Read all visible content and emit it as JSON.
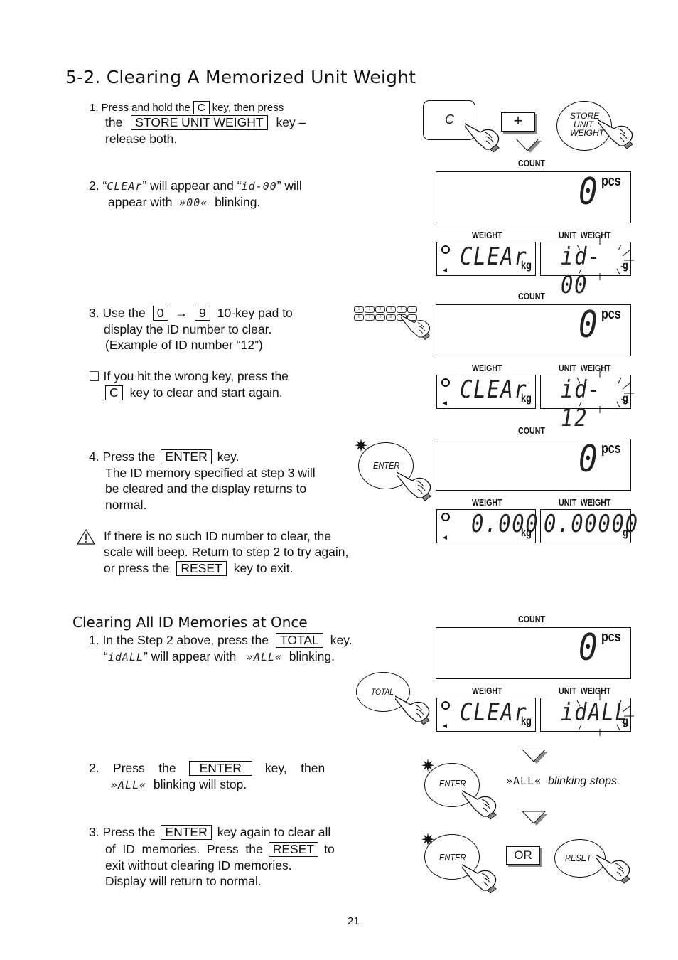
{
  "page": {
    "title": "5-2. Clearing A Memorized Unit Weight",
    "page_number": "21"
  },
  "section1": {
    "step1": {
      "l1_a": "1. Press and hold the",
      "key_c": "C",
      "l1_b": "key, then press",
      "l2_a": "the",
      "key_store": "STORE  UNIT  WEIGHT",
      "l2_b": "key  –",
      "l3": "release both."
    },
    "step2": {
      "l1_a": "2. “",
      "seg_clear": "CLEAr",
      "l1_b": "”  will  appear  and  “",
      "seg_id": "id-00",
      "l1_c": "”  will",
      "l2_a": "appear with",
      "seg_blink": "»00«",
      "l2_b": "blinking."
    },
    "step3": {
      "l1_a": "3.  Use  the",
      "key_0": "0",
      "arrow": "→",
      "key_9": "9",
      "l1_b": "10-key  pad  to",
      "l2": "display the ID number to clear.",
      "l3": "(Example of ID number “12”)",
      "note_l1": "❏ If you hit the wrong key, press the",
      "key_c": "C",
      "note_l2": "key to clear and start again."
    },
    "step4": {
      "l1_a": "4. Press the",
      "key_enter": "ENTER",
      "l1_b": "key.",
      "l2": "The ID memory specified at step 3 will",
      "l3": "be  cleared  and  the  display  returns  to",
      "l4": "normal.",
      "warn_l1": "If  there  is  no  such  ID  number  to  clear,  the",
      "warn_l2": "scale will beep. Return to step 2 to try again,",
      "warn_l3_a": "or press the",
      "key_reset": "RESET",
      "warn_l3_b": "key to exit."
    }
  },
  "section2": {
    "title": "Clearing All ID Memories at Once",
    "step1": {
      "l1_a": "1. In the Step 2 above, press the",
      "key_total": "TOTAL",
      "l1_b": "key.",
      "l2_a": "“",
      "seg_idall": "idALL",
      "l2_b": "” will appear with",
      "seg_blink": "»ALL«",
      "l2_c": "blinking."
    },
    "step2": {
      "l1_a": "2.    Press    the",
      "key_enter": "ENTER",
      "l1_b": "key,    then",
      "seg_blink": "»ALL«",
      "l2": "blinking will stop."
    },
    "step3": {
      "l1_a": "3. Press the",
      "key_enter": "ENTER",
      "l1_b": "key again to clear all",
      "l2_a": "of  ID  memories.  Press  the",
      "key_reset": "RESET",
      "l2_b": "to",
      "l3": "exit without clearing ID memories.",
      "l4": "Display will return to normal."
    }
  },
  "figures": {
    "buttons": {
      "c": "C",
      "plus": "+",
      "store": [
        "STORE",
        "UNIT",
        "WEIGHT"
      ],
      "enter": "ENTER",
      "total": "TOTAL",
      "reset": "RESET",
      "or": "OR"
    },
    "labels": {
      "count": "COUNT",
      "weight": "WEIGHT",
      "unit_weight": "UNIT  WEIGHT",
      "pcs": "pcs",
      "kg": "kg",
      "g": "g"
    },
    "displays": [
      {
        "count": "0",
        "weight": "CLEAr",
        "unit_weight": "id-00"
      },
      {
        "count": "0",
        "weight": "CLEAr",
        "unit_weight": "id-12"
      },
      {
        "count": "0",
        "weight": "0.000",
        "unit_weight": "0.00000"
      },
      {
        "count": "0",
        "weight": "CLEAr",
        "unit_weight": "idALL"
      }
    ],
    "keypad_row1": [
      "1",
      "2",
      "3",
      "4",
      "5",
      "•"
    ],
    "keypad_row2": [
      "6",
      "7",
      "8",
      "9",
      "0",
      "←"
    ],
    "blink_stops_seg": "»ALL«",
    "blink_stops_text": "blinking stops."
  }
}
